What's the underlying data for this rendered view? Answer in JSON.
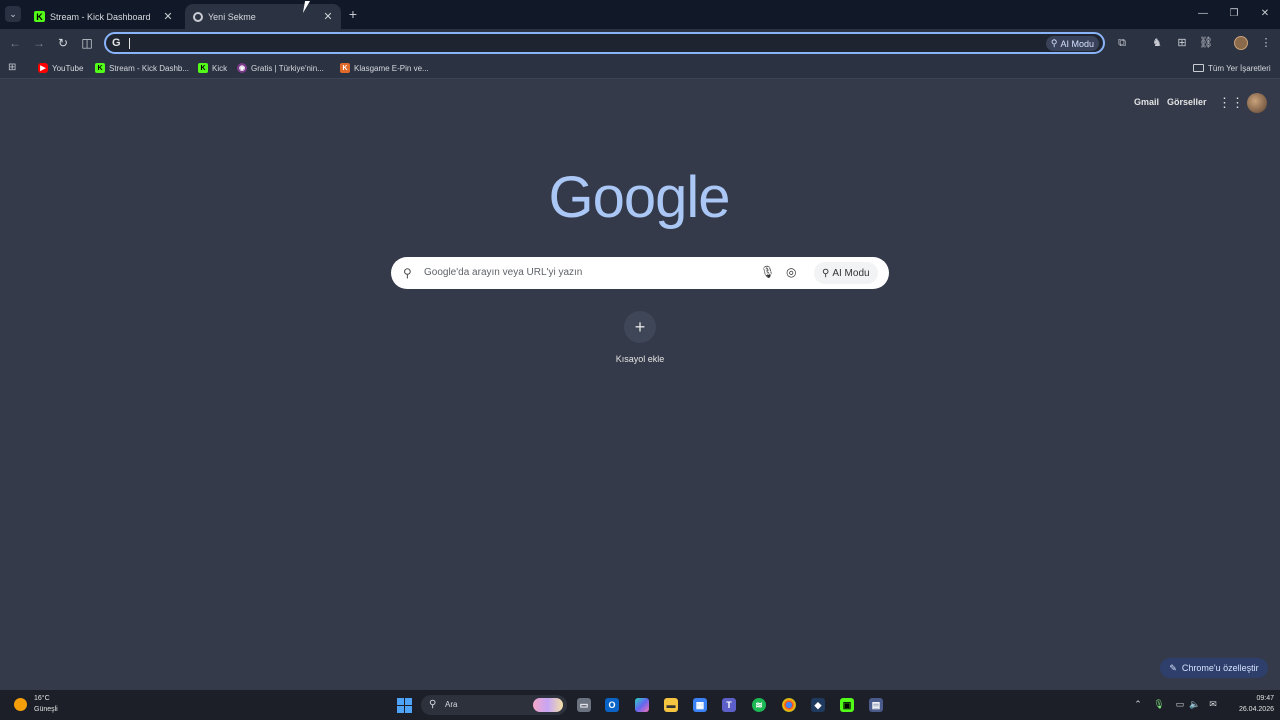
{
  "browser": {
    "tabs": [
      {
        "title": "Stream - Kick Dashboard",
        "favicon": "kick-icon",
        "active": false
      },
      {
        "title": "Yeni Sekme",
        "favicon": "chrome-icon",
        "active": true
      }
    ],
    "omnibox": {
      "value": "",
      "ai_mode_label": "AI Modu"
    },
    "bookmarks": [
      {
        "label": "YouTube",
        "favicon": "youtube-icon"
      },
      {
        "label": "Stream - Kick Dashb...",
        "favicon": "kick-icon"
      },
      {
        "label": "Kick",
        "favicon": "kick-icon"
      },
      {
        "label": "Gratis | Türkiye'nin...",
        "favicon": "gratis-icon"
      },
      {
        "label": "Klasgame E-Pin ve...",
        "favicon": "klasgame-icon"
      }
    ],
    "all_bookmarks_label": "Tüm Yer İşaretleri"
  },
  "page": {
    "top_links": {
      "gmail": "Gmail",
      "images": "Görseller"
    },
    "logo": "Google",
    "search": {
      "placeholder": "Google'da arayın veya URL'yi yazın",
      "ai_mode_label": "AI Modu"
    },
    "shortcut_add_label": "Kısayol ekle",
    "customize_label": "Chrome'u özelleştir"
  },
  "taskbar": {
    "weather": {
      "temp": "16°C",
      "desc": "Güneşli"
    },
    "search_label": "Ara",
    "clock": {
      "time": "09:47",
      "date": "26.04.2026"
    }
  },
  "colors": {
    "accent": "#8ab4f8",
    "background": "#343a4a"
  }
}
